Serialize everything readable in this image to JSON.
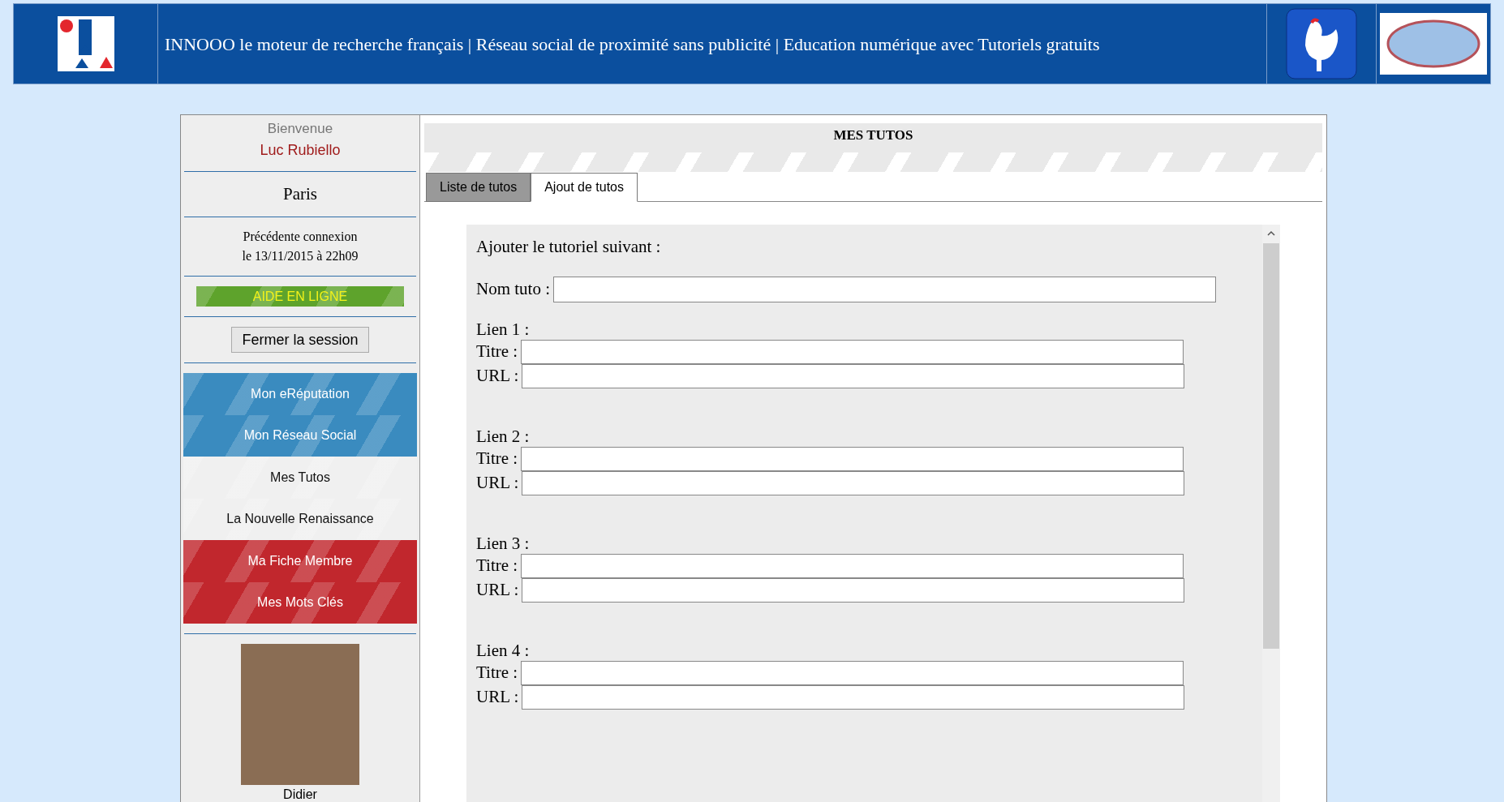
{
  "header": {
    "title": "INNOOO le moteur de recherche français | Réseau social de proximité sans publicité | Education numérique avec Tutoriels gratuits"
  },
  "sidebar": {
    "welcome": "Bienvenue",
    "user": "Luc Rubiello",
    "city": "Paris",
    "last_login": [
      "Précédente connexion",
      "le 13/11/2015 à 22h09"
    ],
    "help_button": "AIDE EN LIGNE",
    "logout_button": "Fermer la session",
    "menu": [
      {
        "label": "Mon eRéputation",
        "color": "#3a8bbf"
      },
      {
        "label": "Mon Réseau Social",
        "color": "#3a8bbf"
      },
      {
        "label": "Mes Tutos",
        "color": "#f0f0f0"
      },
      {
        "label": "La Nouvelle Renaissance",
        "color": "#f0f0f0"
      },
      {
        "label": "Ma Fiche Membre",
        "color": "#c1272d"
      },
      {
        "label": "Mes Mots Clés",
        "color": "#c1272d"
      }
    ],
    "photo_caption": "Didier"
  },
  "main": {
    "title": "MES TUTOS",
    "tabs": [
      {
        "label": "Liste de tutos",
        "selected": false
      },
      {
        "label": "Ajout de tutos",
        "selected": true
      }
    ],
    "form": {
      "heading": "Ajouter le tutoriel suivant :",
      "name_label": "Nom tuto :",
      "links": [
        {
          "label": "Lien 1 :",
          "title_label": "Titre :",
          "url_label": "URL :"
        },
        {
          "label": "Lien 2 :",
          "title_label": "Titre :",
          "url_label": "URL :"
        },
        {
          "label": "Lien 3 :",
          "title_label": "Titre :",
          "url_label": "URL :"
        },
        {
          "label": "Lien 4 :",
          "title_label": "Titre :",
          "url_label": "URL :"
        }
      ]
    }
  }
}
